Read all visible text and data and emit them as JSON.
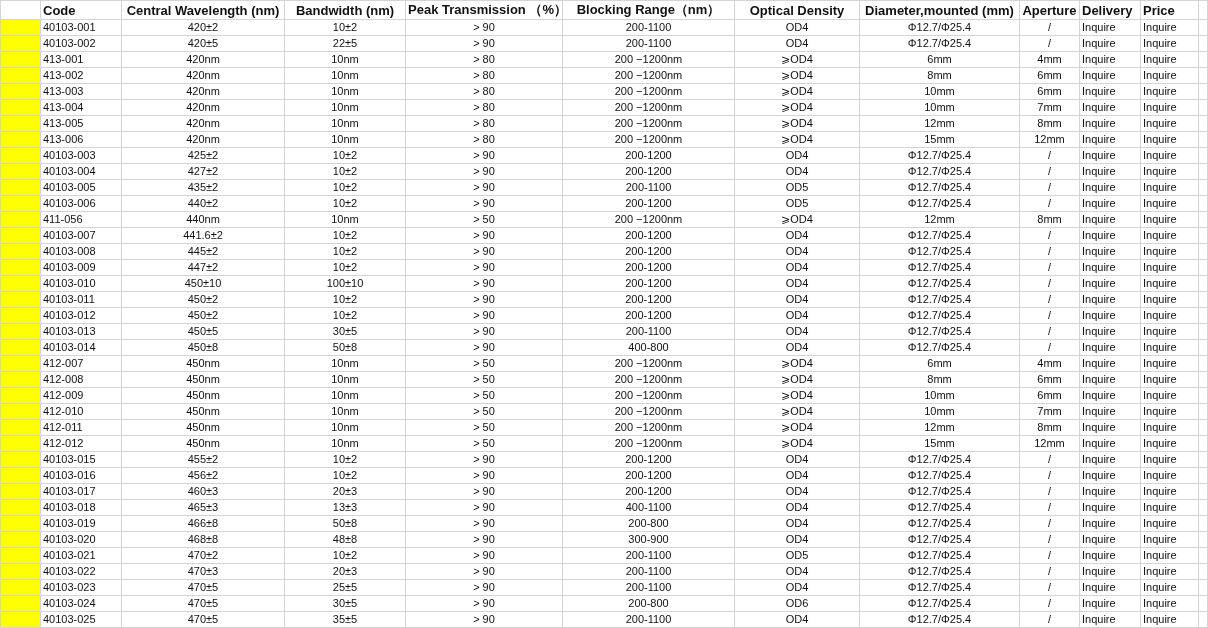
{
  "table": {
    "columns": [
      "Code",
      "Central Wavelength (nm)",
      "Bandwidth (nm)",
      "Peak Transmission （%）",
      "Blocking Range（nm）",
      "Optical Density",
      "Diameter,mounted (mm)",
      "Aperture",
      "Delivery",
      "Price"
    ],
    "rows": [
      [
        "40103-001",
        "420±2",
        "10±2",
        "> 90",
        "200-1100",
        "OD4",
        "Φ12.7/Φ25.4",
        "/",
        "Inquire",
        "Inquire"
      ],
      [
        "40103-002",
        "420±5",
        "22±5",
        "> 90",
        "200-1100",
        "OD4",
        "Φ12.7/Φ25.4",
        "/",
        "Inquire",
        "Inquire"
      ],
      [
        "413-001",
        "420nm",
        "10nm",
        "> 80",
        "200 −1200nm",
        "⩾OD4",
        "6mm",
        "4mm",
        "Inquire",
        "Inquire"
      ],
      [
        "413-002",
        "420nm",
        "10nm",
        "> 80",
        "200 −1200nm",
        "⩾OD4",
        "8mm",
        "6mm",
        "Inquire",
        "Inquire"
      ],
      [
        "413-003",
        "420nm",
        "10nm",
        "> 80",
        "200 −1200nm",
        "⩾OD4",
        "10mm",
        "6mm",
        "Inquire",
        "Inquire"
      ],
      [
        "413-004",
        "420nm",
        "10nm",
        "> 80",
        "200 −1200nm",
        "⩾OD4",
        "10mm",
        "7mm",
        "Inquire",
        "Inquire"
      ],
      [
        "413-005",
        "420nm",
        "10nm",
        "> 80",
        "200 −1200nm",
        "⩾OD4",
        "12mm",
        "8mm",
        "Inquire",
        "Inquire"
      ],
      [
        "413-006",
        "420nm",
        "10nm",
        "> 80",
        "200 −1200nm",
        "⩾OD4",
        "15mm",
        "12mm",
        "Inquire",
        "Inquire"
      ],
      [
        "40103-003",
        "425±2",
        "10±2",
        "> 90",
        "200-1200",
        "OD4",
        "Φ12.7/Φ25.4",
        "/",
        "Inquire",
        "Inquire"
      ],
      [
        "40103-004",
        "427±2",
        "10±2",
        "> 90",
        "200-1200",
        "OD4",
        "Φ12.7/Φ25.4",
        "/",
        "Inquire",
        "Inquire"
      ],
      [
        "40103-005",
        "435±2",
        "10±2",
        "> 90",
        "200-1100",
        "OD5",
        "Φ12.7/Φ25.4",
        "/",
        "Inquire",
        "Inquire"
      ],
      [
        "40103-006",
        "440±2",
        "10±2",
        "> 90",
        "200-1200",
        "OD5",
        "Φ12.7/Φ25.4",
        "/",
        "Inquire",
        "Inquire"
      ],
      [
        "411-056",
        "440nm",
        "10nm",
        "> 50",
        "200 −1200nm",
        "⩾OD4",
        "12mm",
        "8mm",
        "Inquire",
        "Inquire"
      ],
      [
        "40103-007",
        "441.6±2",
        "10±2",
        "> 90",
        "200-1200",
        "OD4",
        "Φ12.7/Φ25.4",
        "/",
        "Inquire",
        "Inquire"
      ],
      [
        "40103-008",
        "445±2",
        "10±2",
        "> 90",
        "200-1200",
        "OD4",
        "Φ12.7/Φ25.4",
        "/",
        "Inquire",
        "Inquire"
      ],
      [
        "40103-009",
        "447±2",
        "10±2",
        "> 90",
        "200-1200",
        "OD4",
        "Φ12.7/Φ25.4",
        "/",
        "Inquire",
        "Inquire"
      ],
      [
        "40103-010",
        "450±10",
        "100±10",
        "> 90",
        "200-1200",
        "OD4",
        "Φ12.7/Φ25.4",
        "/",
        "Inquire",
        "Inquire"
      ],
      [
        "40103-011",
        "450±2",
        "10±2",
        "> 90",
        "200-1200",
        "OD4",
        "Φ12.7/Φ25.4",
        "/",
        "Inquire",
        "Inquire"
      ],
      [
        "40103-012",
        "450±2",
        "10±2",
        "> 90",
        "200-1200",
        "OD4",
        "Φ12.7/Φ25.4",
        "/",
        "Inquire",
        "Inquire"
      ],
      [
        "40103-013",
        "450±5",
        "30±5",
        "> 90",
        "200-1100",
        "OD4",
        "Φ12.7/Φ25.4",
        "/",
        "Inquire",
        "Inquire"
      ],
      [
        "40103-014",
        "450±8",
        "50±8",
        "> 90",
        "400-800",
        "OD4",
        "Φ12.7/Φ25.4",
        "/",
        "Inquire",
        "Inquire"
      ],
      [
        "412-007",
        "450nm",
        "10nm",
        "> 50",
        "200 −1200nm",
        "⩾OD4",
        "6mm",
        "4mm",
        "Inquire",
        "Inquire"
      ],
      [
        "412-008",
        "450nm",
        "10nm",
        "> 50",
        "200 −1200nm",
        "⩾OD4",
        "8mm",
        "6mm",
        "Inquire",
        "Inquire"
      ],
      [
        "412-009",
        "450nm",
        "10nm",
        "> 50",
        "200 −1200nm",
        "⩾OD4",
        "10mm",
        "6mm",
        "Inquire",
        "Inquire"
      ],
      [
        "412-010",
        "450nm",
        "10nm",
        "> 50",
        "200 −1200nm",
        "⩾OD4",
        "10mm",
        "7mm",
        "Inquire",
        "Inquire"
      ],
      [
        "412-011",
        "450nm",
        "10nm",
        "> 50",
        "200 −1200nm",
        "⩾OD4",
        "12mm",
        "8mm",
        "Inquire",
        "Inquire"
      ],
      [
        "412-012",
        "450nm",
        "10nm",
        "> 50",
        "200 −1200nm",
        "⩾OD4",
        "15mm",
        "12mm",
        "Inquire",
        "Inquire"
      ],
      [
        "40103-015",
        "455±2",
        "10±2",
        "> 90",
        "200-1200",
        "OD4",
        "Φ12.7/Φ25.4",
        "/",
        "Inquire",
        "Inquire"
      ],
      [
        "40103-016",
        "456±2",
        "10±2",
        "> 90",
        "200-1200",
        "OD4",
        "Φ12.7/Φ25.4",
        "/",
        "Inquire",
        "Inquire"
      ],
      [
        "40103-017",
        "460±3",
        "20±3",
        "> 90",
        "200-1200",
        "OD4",
        "Φ12.7/Φ25.4",
        "/",
        "Inquire",
        "Inquire"
      ],
      [
        "40103-018",
        "465±3",
        "13±3",
        "> 90",
        "400-1100",
        "OD4",
        "Φ12.7/Φ25.4",
        "/",
        "Inquire",
        "Inquire"
      ],
      [
        "40103-019",
        "466±8",
        "50±8",
        "> 90",
        "200-800",
        "OD4",
        "Φ12.7/Φ25.4",
        "/",
        "Inquire",
        "Inquire"
      ],
      [
        "40103-020",
        "468±8",
        "48±8",
        "> 90",
        "300-900",
        "OD4",
        "Φ12.7/Φ25.4",
        "/",
        "Inquire",
        "Inquire"
      ],
      [
        "40103-021",
        "470±2",
        "10±2",
        "> 90",
        "200-1100",
        "OD5",
        "Φ12.7/Φ25.4",
        "/",
        "Inquire",
        "Inquire"
      ],
      [
        "40103-022",
        "470±3",
        "20±3",
        "> 90",
        "200-1100",
        "OD4",
        "Φ12.7/Φ25.4",
        "/",
        "Inquire",
        "Inquire"
      ],
      [
        "40103-023",
        "470±5",
        "25±5",
        "> 90",
        "200-1100",
        "OD4",
        "Φ12.7/Φ25.4",
        "/",
        "Inquire",
        "Inquire"
      ],
      [
        "40103-024",
        "470±5",
        "30±5",
        "> 90",
        "200-800",
        "OD6",
        "Φ12.7/Φ25.4",
        "/",
        "Inquire",
        "Inquire"
      ],
      [
        "40103-025",
        "470±5",
        "35±5",
        "> 90",
        "200-1100",
        "OD4",
        "Φ12.7/Φ25.4",
        "/",
        "Inquire",
        "Inquire"
      ]
    ]
  }
}
